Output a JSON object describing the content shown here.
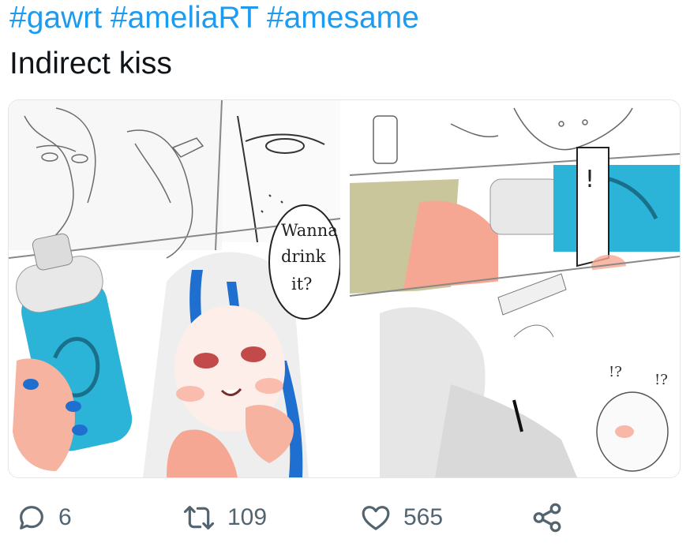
{
  "tweet": {
    "hashtags": [
      "#gawrt",
      "#ameliaRT",
      "#amesame"
    ],
    "text": "Indirect kiss"
  },
  "media": {
    "left_panel": {
      "speech_bubble_lines": [
        "Wanna",
        "drink",
        "it?"
      ]
    },
    "right_panel": {
      "exclaim_1": "!?",
      "exclaim_2": "!?"
    }
  },
  "actions": {
    "reply": {
      "icon": "reply-icon",
      "count": "6"
    },
    "retweet": {
      "icon": "retweet-icon",
      "count": "109"
    },
    "like": {
      "icon": "heart-icon",
      "count": "565"
    },
    "share": {
      "icon": "share-icon"
    }
  },
  "colors": {
    "link": "#1d9bf0",
    "text": "#0f1419",
    "icon": "#536471",
    "bottle_blue": "#2bb3d8",
    "hair_blue": "#1e6fd0",
    "skin_pink": "#f6a793",
    "blonde": "#c8c69a"
  }
}
